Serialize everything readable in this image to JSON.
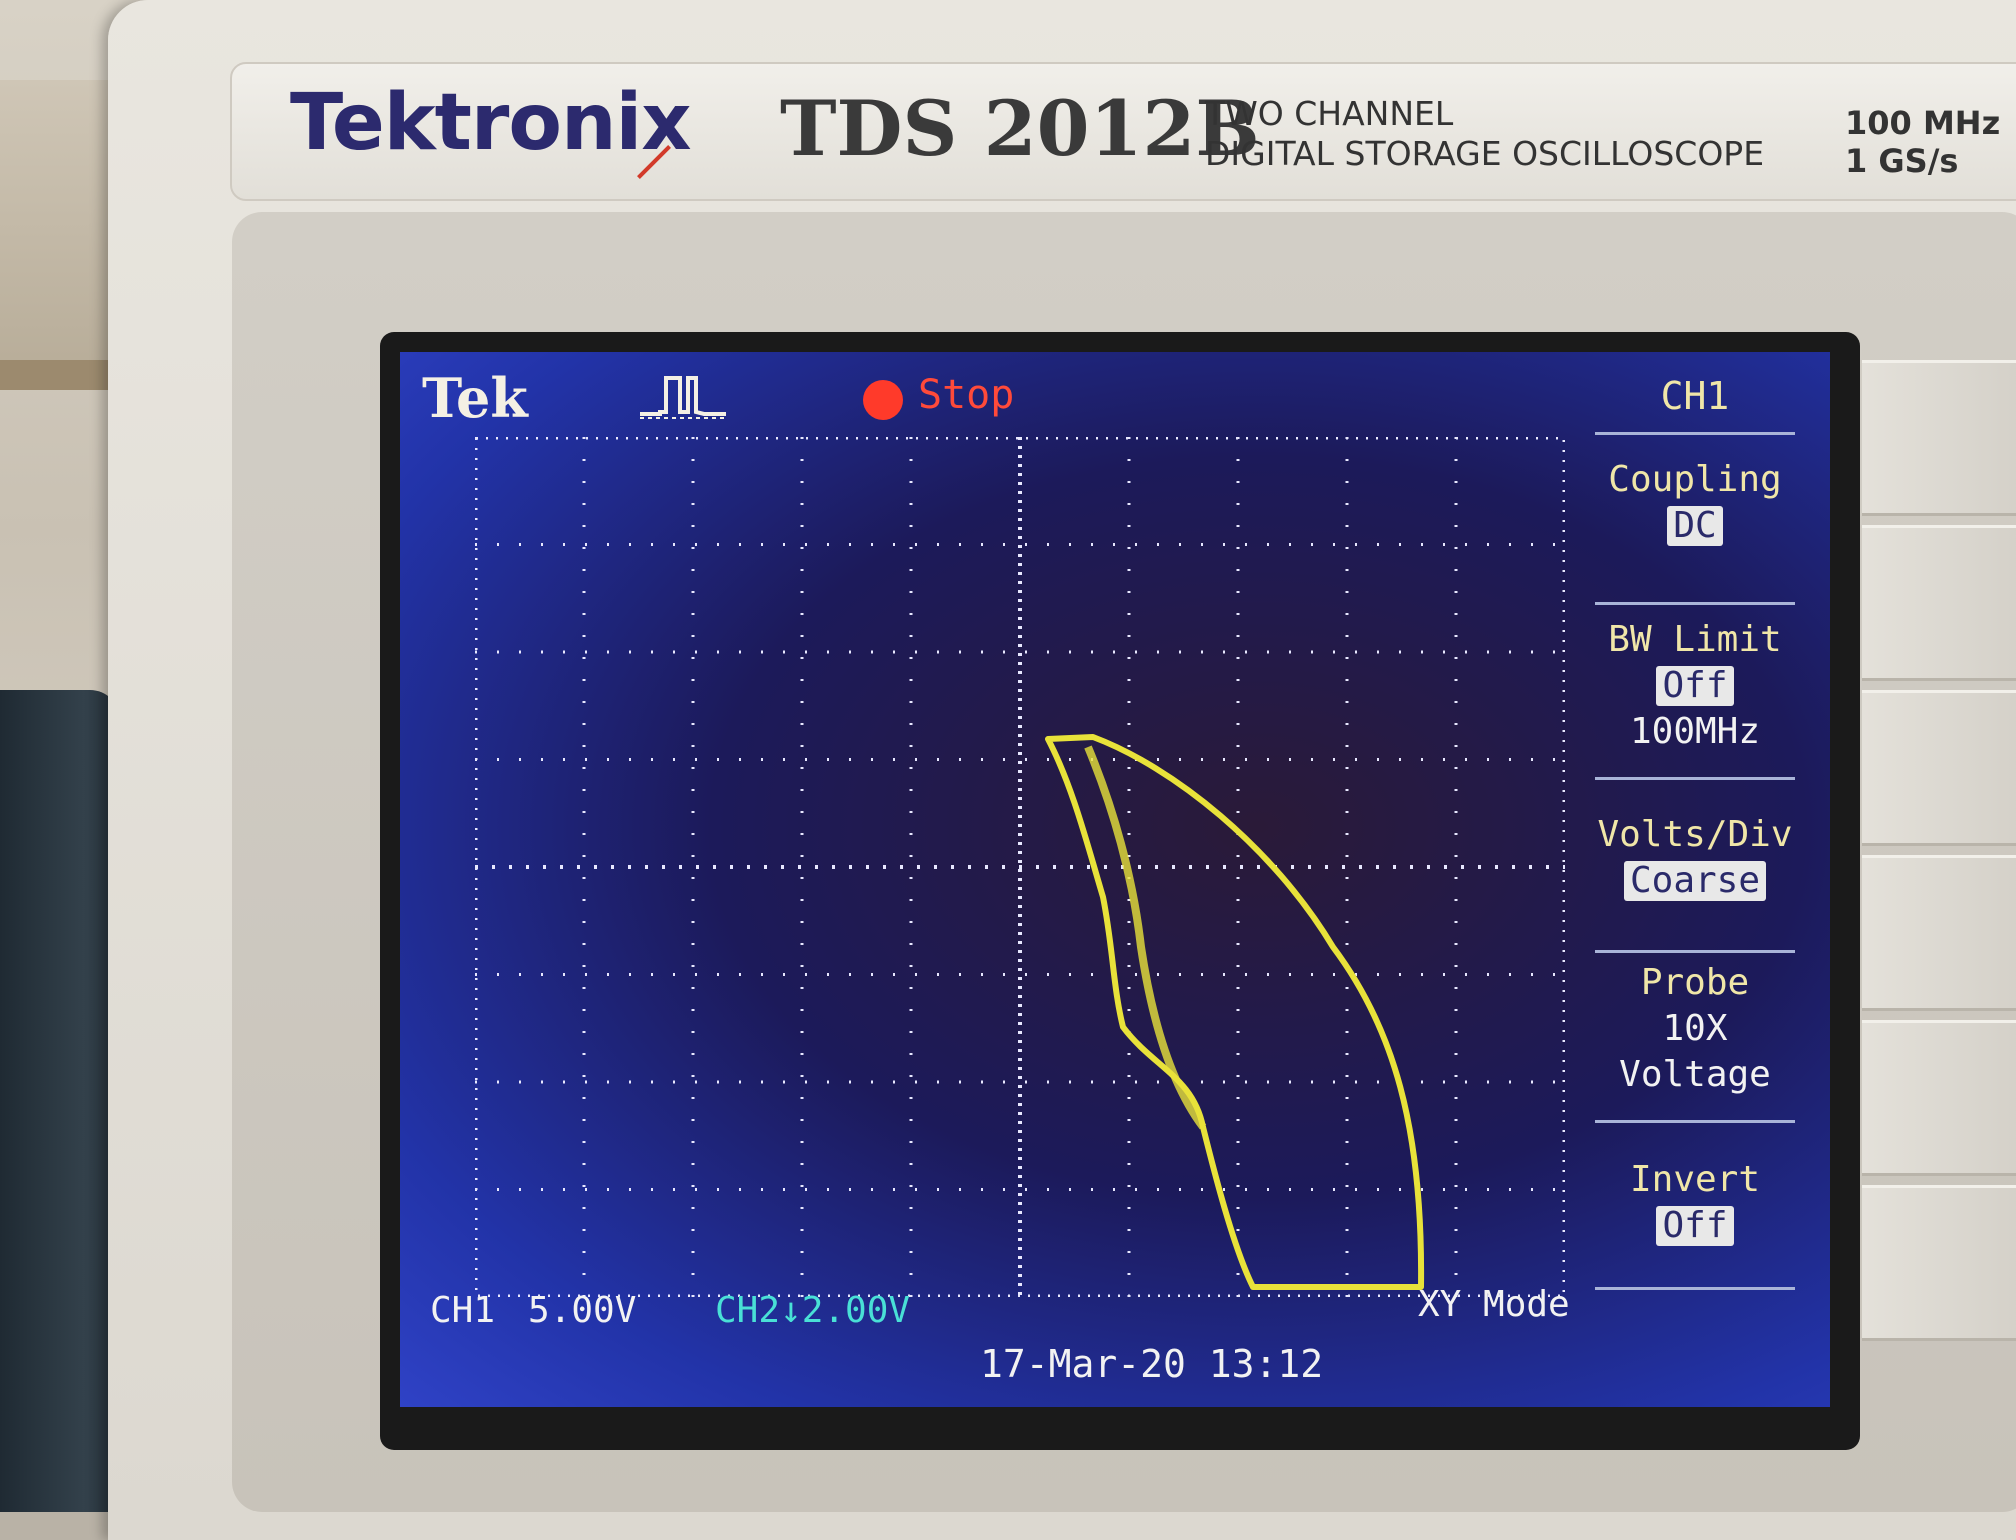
{
  "scope_panel": {
    "brand": "Tektronix",
    "model": "TDS 2012B",
    "description_line1": "TWO  CHANNEL",
    "description_line2": "DIGITAL STORAGE OSCILLOSCOPE",
    "spec_bandwidth": "100 MHz",
    "spec_sample_rate": "1 GS/s"
  },
  "display": {
    "logo": "Tek",
    "acquisition_state": "Stop",
    "ch1_label": "CH1",
    "ch1_scale": "5.00V",
    "ch2_readout": "CH2↓2.00V",
    "mode": "XY Mode",
    "timestamp": "17-Mar-20 13:12"
  },
  "menu": {
    "title": "CH1",
    "items": [
      {
        "label": "Coupling",
        "value": "DC"
      },
      {
        "label": "BW Limit",
        "value": "Off",
        "extra": "100MHz"
      },
      {
        "label": "Volts/Div",
        "value": "Coarse"
      },
      {
        "label": "Probe",
        "value": "10X",
        "extra": "Voltage"
      },
      {
        "label": "Invert",
        "value": "Off"
      }
    ]
  },
  "colors": {
    "trace": "#e8e23a",
    "menu_label": "#f0e6a8",
    "ch2_text": "#49e0d6",
    "stop_indicator": "#ff3a2a"
  }
}
